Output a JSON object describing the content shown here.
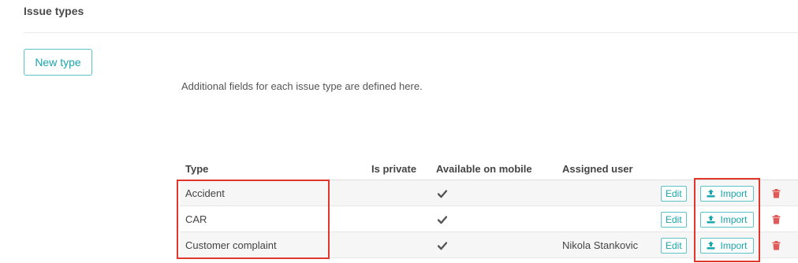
{
  "page": {
    "title": "Issue types",
    "new_type_label": "New type",
    "description": "Additional fields for each issue type are defined here."
  },
  "table": {
    "headers": {
      "type": "Type",
      "is_private": "Is private",
      "available_on_mobile": "Available on mobile",
      "assigned_user": "Assigned user"
    },
    "rows": [
      {
        "type": "Accident",
        "is_private": false,
        "available_on_mobile": true,
        "assigned_user": "",
        "edit_label": "Edit",
        "import_label": "Import"
      },
      {
        "type": "CAR",
        "is_private": false,
        "available_on_mobile": true,
        "assigned_user": "",
        "edit_label": "Edit",
        "import_label": "Import"
      },
      {
        "type": "Customer complaint",
        "is_private": false,
        "available_on_mobile": true,
        "assigned_user": "Nikola Stankovic",
        "edit_label": "Edit",
        "import_label": "Import"
      }
    ]
  },
  "icons": {
    "mobile": "check-icon",
    "import": "upload-icon",
    "delete": "trash-icon"
  },
  "colors": {
    "accent": "#19a6ad",
    "accent_border": "#5ec3c6",
    "delete": "#e05a5a",
    "highlight": "#e0362b"
  }
}
